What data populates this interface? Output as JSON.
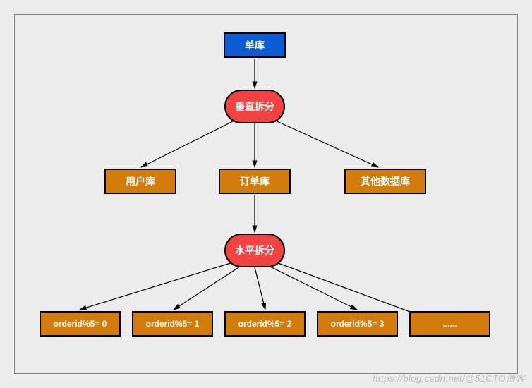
{
  "root": {
    "label": "单库"
  },
  "split_vertical": {
    "label": "垂直拆分"
  },
  "db_user": {
    "label": "用户库"
  },
  "db_order": {
    "label": "订单库"
  },
  "db_other": {
    "label": "其他数据库"
  },
  "split_horizontal": {
    "label": "水平拆分"
  },
  "shards": [
    {
      "label": "orderid%5= 0"
    },
    {
      "label": "orderid%5= 1"
    },
    {
      "label": "orderid%5= 2"
    },
    {
      "label": "orderid%5= 3"
    },
    {
      "label": "......"
    }
  ],
  "watermark": "https://blog.csdn.net/@51CTO博客"
}
